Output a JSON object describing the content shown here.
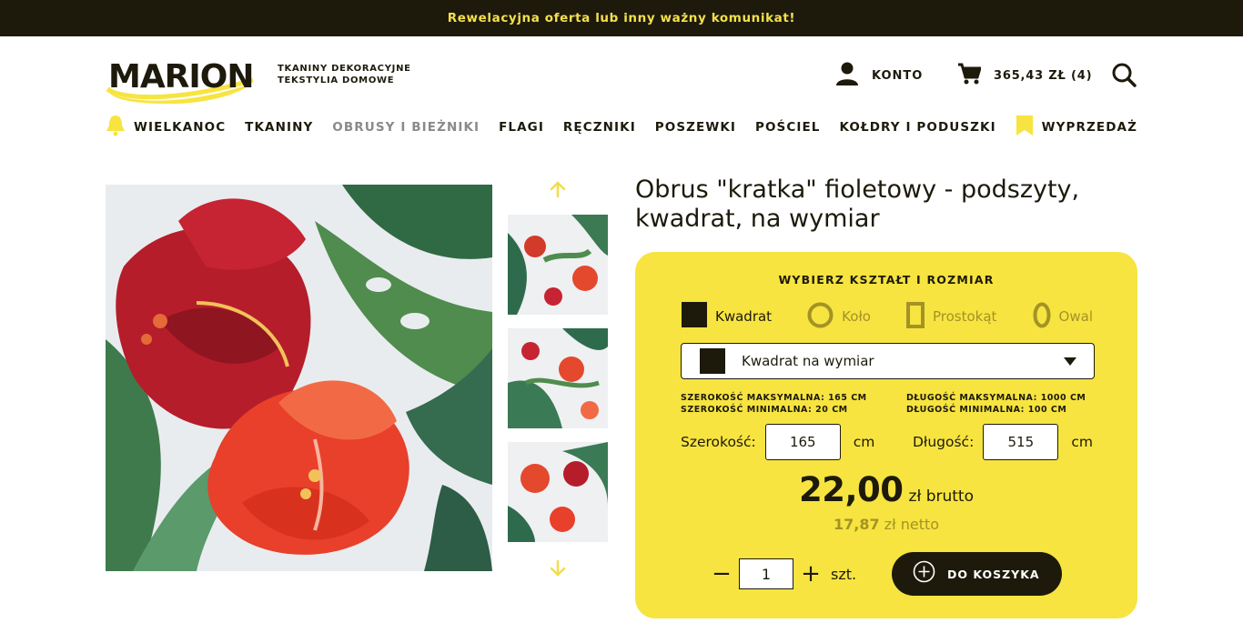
{
  "announcement": "Rewelacyjna oferta lub inny ważny komunikat!",
  "header": {
    "logo_text": "MARION",
    "tagline_line1": "TKANINY DEKORACYJNE",
    "tagline_line2": "TEKSTYLIA DOMOWE",
    "account_label": "KONTO",
    "cart_label": "365,43 ZŁ (4)",
    "icons": [
      "user-icon",
      "cart-icon",
      "search-icon"
    ]
  },
  "nav": {
    "items": [
      {
        "label": "WIELKANOC",
        "icon": "bell-icon"
      },
      {
        "label": "TKANINY"
      },
      {
        "label": "OBRUSY I BIEŻNIKI",
        "active": true
      },
      {
        "label": "FLAGI"
      },
      {
        "label": "RĘCZNIKI"
      },
      {
        "label": "POSZEWKI"
      },
      {
        "label": "POŚCIEL"
      },
      {
        "label": "KOŁDRY I PODUSZKI"
      },
      {
        "label": "WYPRZEDAŻ",
        "icon": "bookmark-icon"
      }
    ]
  },
  "product": {
    "title": "Obrus \"kratka\" fioletowy - podszyty, kwadrat, na wymiar",
    "panel_heading": "WYBIERZ KSZTAŁT I ROZMIAR",
    "shapes": [
      {
        "label": "Kwadrat",
        "selected": true
      },
      {
        "label": "Koło"
      },
      {
        "label": "Prostokąt"
      },
      {
        "label": "Owal"
      }
    ],
    "size_select": "Kwadrat na wymiar",
    "width_max": "SZEROKOŚĆ MAKSYMALNA: 165 CM",
    "width_min": "SZEROKOŚĆ MINIMALNA: 20 CM",
    "length_max": "DŁUGOŚĆ MAKSYMALNA: 1000 CM",
    "length_min": "DŁUGOŚĆ MINIMALNA: 100 CM",
    "width_label": "Szerokość:",
    "width_value": "165",
    "length_label": "Długość:",
    "length_value": "515",
    "unit_cm": "cm",
    "price_gross": "22,00",
    "gross_unit": "zł brutto",
    "price_net": "17,87",
    "net_unit": "zł netto",
    "quantity": "1",
    "qty_unit": "szt.",
    "minus": "−",
    "plus": "+",
    "add_to_cart": "DO KOSZYKA"
  },
  "colors": {
    "dark": "#1d1a0c",
    "accent_yellow": "#f7e440",
    "announcement_text": "#f4e04d",
    "muted_olive": "#a39326"
  }
}
